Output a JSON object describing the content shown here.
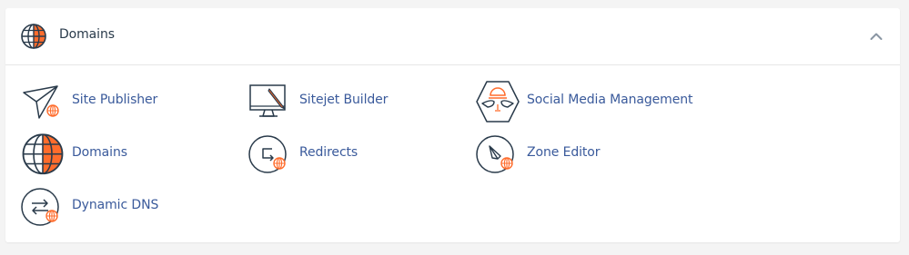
{
  "section": {
    "title": "Domains",
    "header_icon": "globe-icon",
    "collapse_icon": "chevron-up-icon"
  },
  "colors": {
    "accent": "#ff6c2c",
    "link": "#3a5a9b",
    "icon_stroke": "#293a4a",
    "title": "#293a4a"
  },
  "items": [
    {
      "label": "Site Publisher",
      "icon": "paper-plane-icon"
    },
    {
      "label": "Sitejet Builder",
      "icon": "monitor-pencil-icon"
    },
    {
      "label": "Social Media Management",
      "icon": "hexagon-chat-icon"
    },
    {
      "label": "Domains",
      "icon": "globe-icon"
    },
    {
      "label": "Redirects",
      "icon": "redirect-arrow-icon"
    },
    {
      "label": "Zone Editor",
      "icon": "compass-icon"
    },
    {
      "label": "Dynamic DNS",
      "icon": "swap-arrows-icon"
    }
  ]
}
